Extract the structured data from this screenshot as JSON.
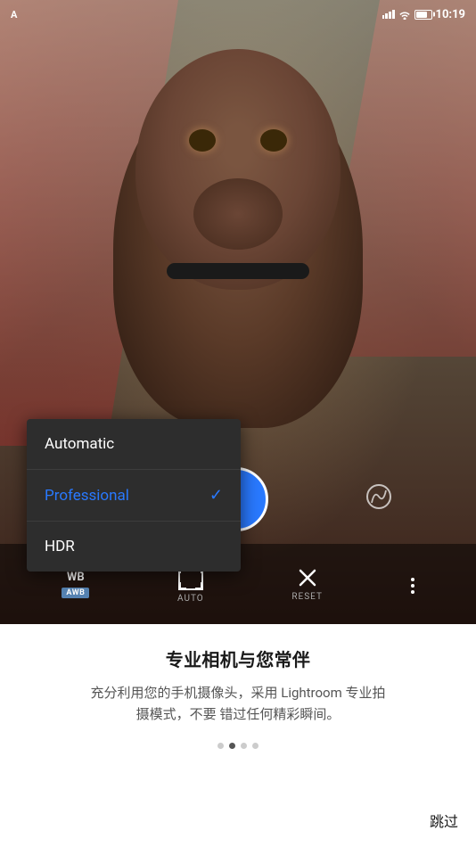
{
  "status_bar": {
    "left_icon": "A",
    "time": "10:19",
    "battery_percent": 80
  },
  "camera": {
    "wb_label": "WB",
    "awb_badge": "AWB",
    "auto_label": "AUTO",
    "reset_label": "RESET",
    "mode_label": "PROFESSIONAL"
  },
  "dropdown": {
    "items": [
      {
        "label": "Automatic",
        "selected": false
      },
      {
        "label": "Professional",
        "selected": true
      },
      {
        "label": "HDR",
        "selected": false
      }
    ]
  },
  "bottom": {
    "title": "专业相机与您常伴",
    "description": "充分利用您的手机摄像头，采用\nLightroom 专业拍摄模式，不要\n错过任何精彩瞬间。",
    "pagination": [
      "",
      "",
      "",
      ""
    ],
    "active_dot": 1,
    "skip_label": "跳过"
  }
}
